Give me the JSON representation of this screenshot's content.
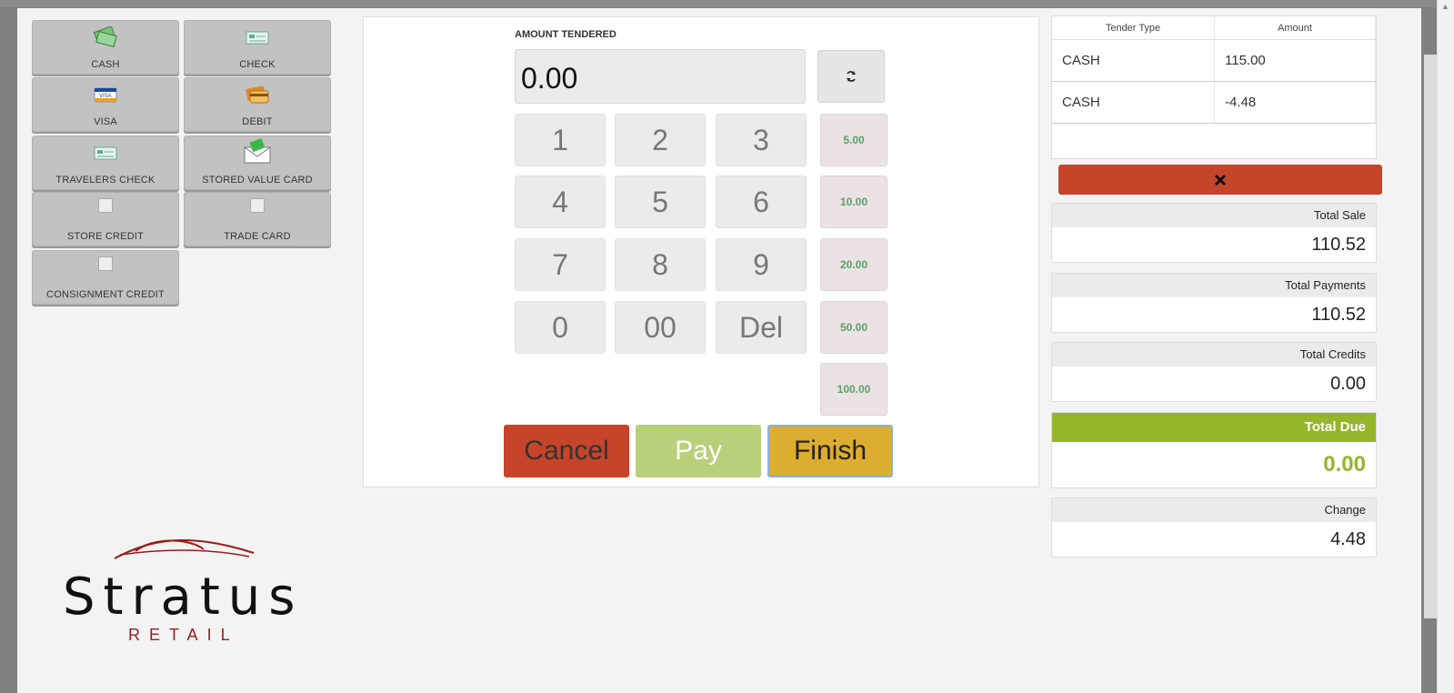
{
  "tenders": [
    {
      "label": "CASH",
      "icon": "cash-icon"
    },
    {
      "label": "CHECK",
      "icon": "check-icon"
    },
    {
      "label": "VISA",
      "icon": "visa-card-icon"
    },
    {
      "label": "DEBIT",
      "icon": "debit-card-icon"
    },
    {
      "label": "TRAVELERS CHECK",
      "icon": "travelers-check-icon"
    },
    {
      "label": "STORED VALUE CARD",
      "icon": "envelope-card-icon"
    },
    {
      "label": "STORE CREDIT",
      "icon": "broken-image-icon"
    },
    {
      "label": "TRADE CARD",
      "icon": "broken-image-icon"
    },
    {
      "label": "CONSIGNMENT CREDIT",
      "icon": "broken-image-icon"
    }
  ],
  "amount": {
    "label": "AMOUNT TENDERED",
    "value": "0.00"
  },
  "keypad": [
    "1",
    "2",
    "3",
    "4",
    "5",
    "6",
    "7",
    "8",
    "9",
    "0",
    "00",
    "Del"
  ],
  "quick_amounts": [
    "5.00",
    "10.00",
    "20.00",
    "50.00",
    "100.00"
  ],
  "actions": {
    "cancel": "Cancel",
    "pay": "Pay",
    "finish": "Finish"
  },
  "tender_table": {
    "headers": [
      "Tender Type",
      "Amount"
    ],
    "rows": [
      {
        "type": "CASH",
        "amount": "115.00"
      },
      {
        "type": "CASH",
        "amount": "-4.48"
      }
    ]
  },
  "totals": {
    "sale": {
      "label": "Total Sale",
      "value": "110.52"
    },
    "payments": {
      "label": "Total Payments",
      "value": "110.52"
    },
    "credits": {
      "label": "Total Credits",
      "value": "0.00"
    },
    "due": {
      "label": "Total Due",
      "value": "0.00"
    },
    "change": {
      "label": "Change",
      "value": "4.48"
    }
  },
  "logo": {
    "brand": "Stratus",
    "sub": "RETAIL"
  },
  "colors": {
    "cancel": "#c5442a",
    "pay": "#b9cf7a",
    "finish": "#dcad30",
    "due": "#95b52a"
  }
}
